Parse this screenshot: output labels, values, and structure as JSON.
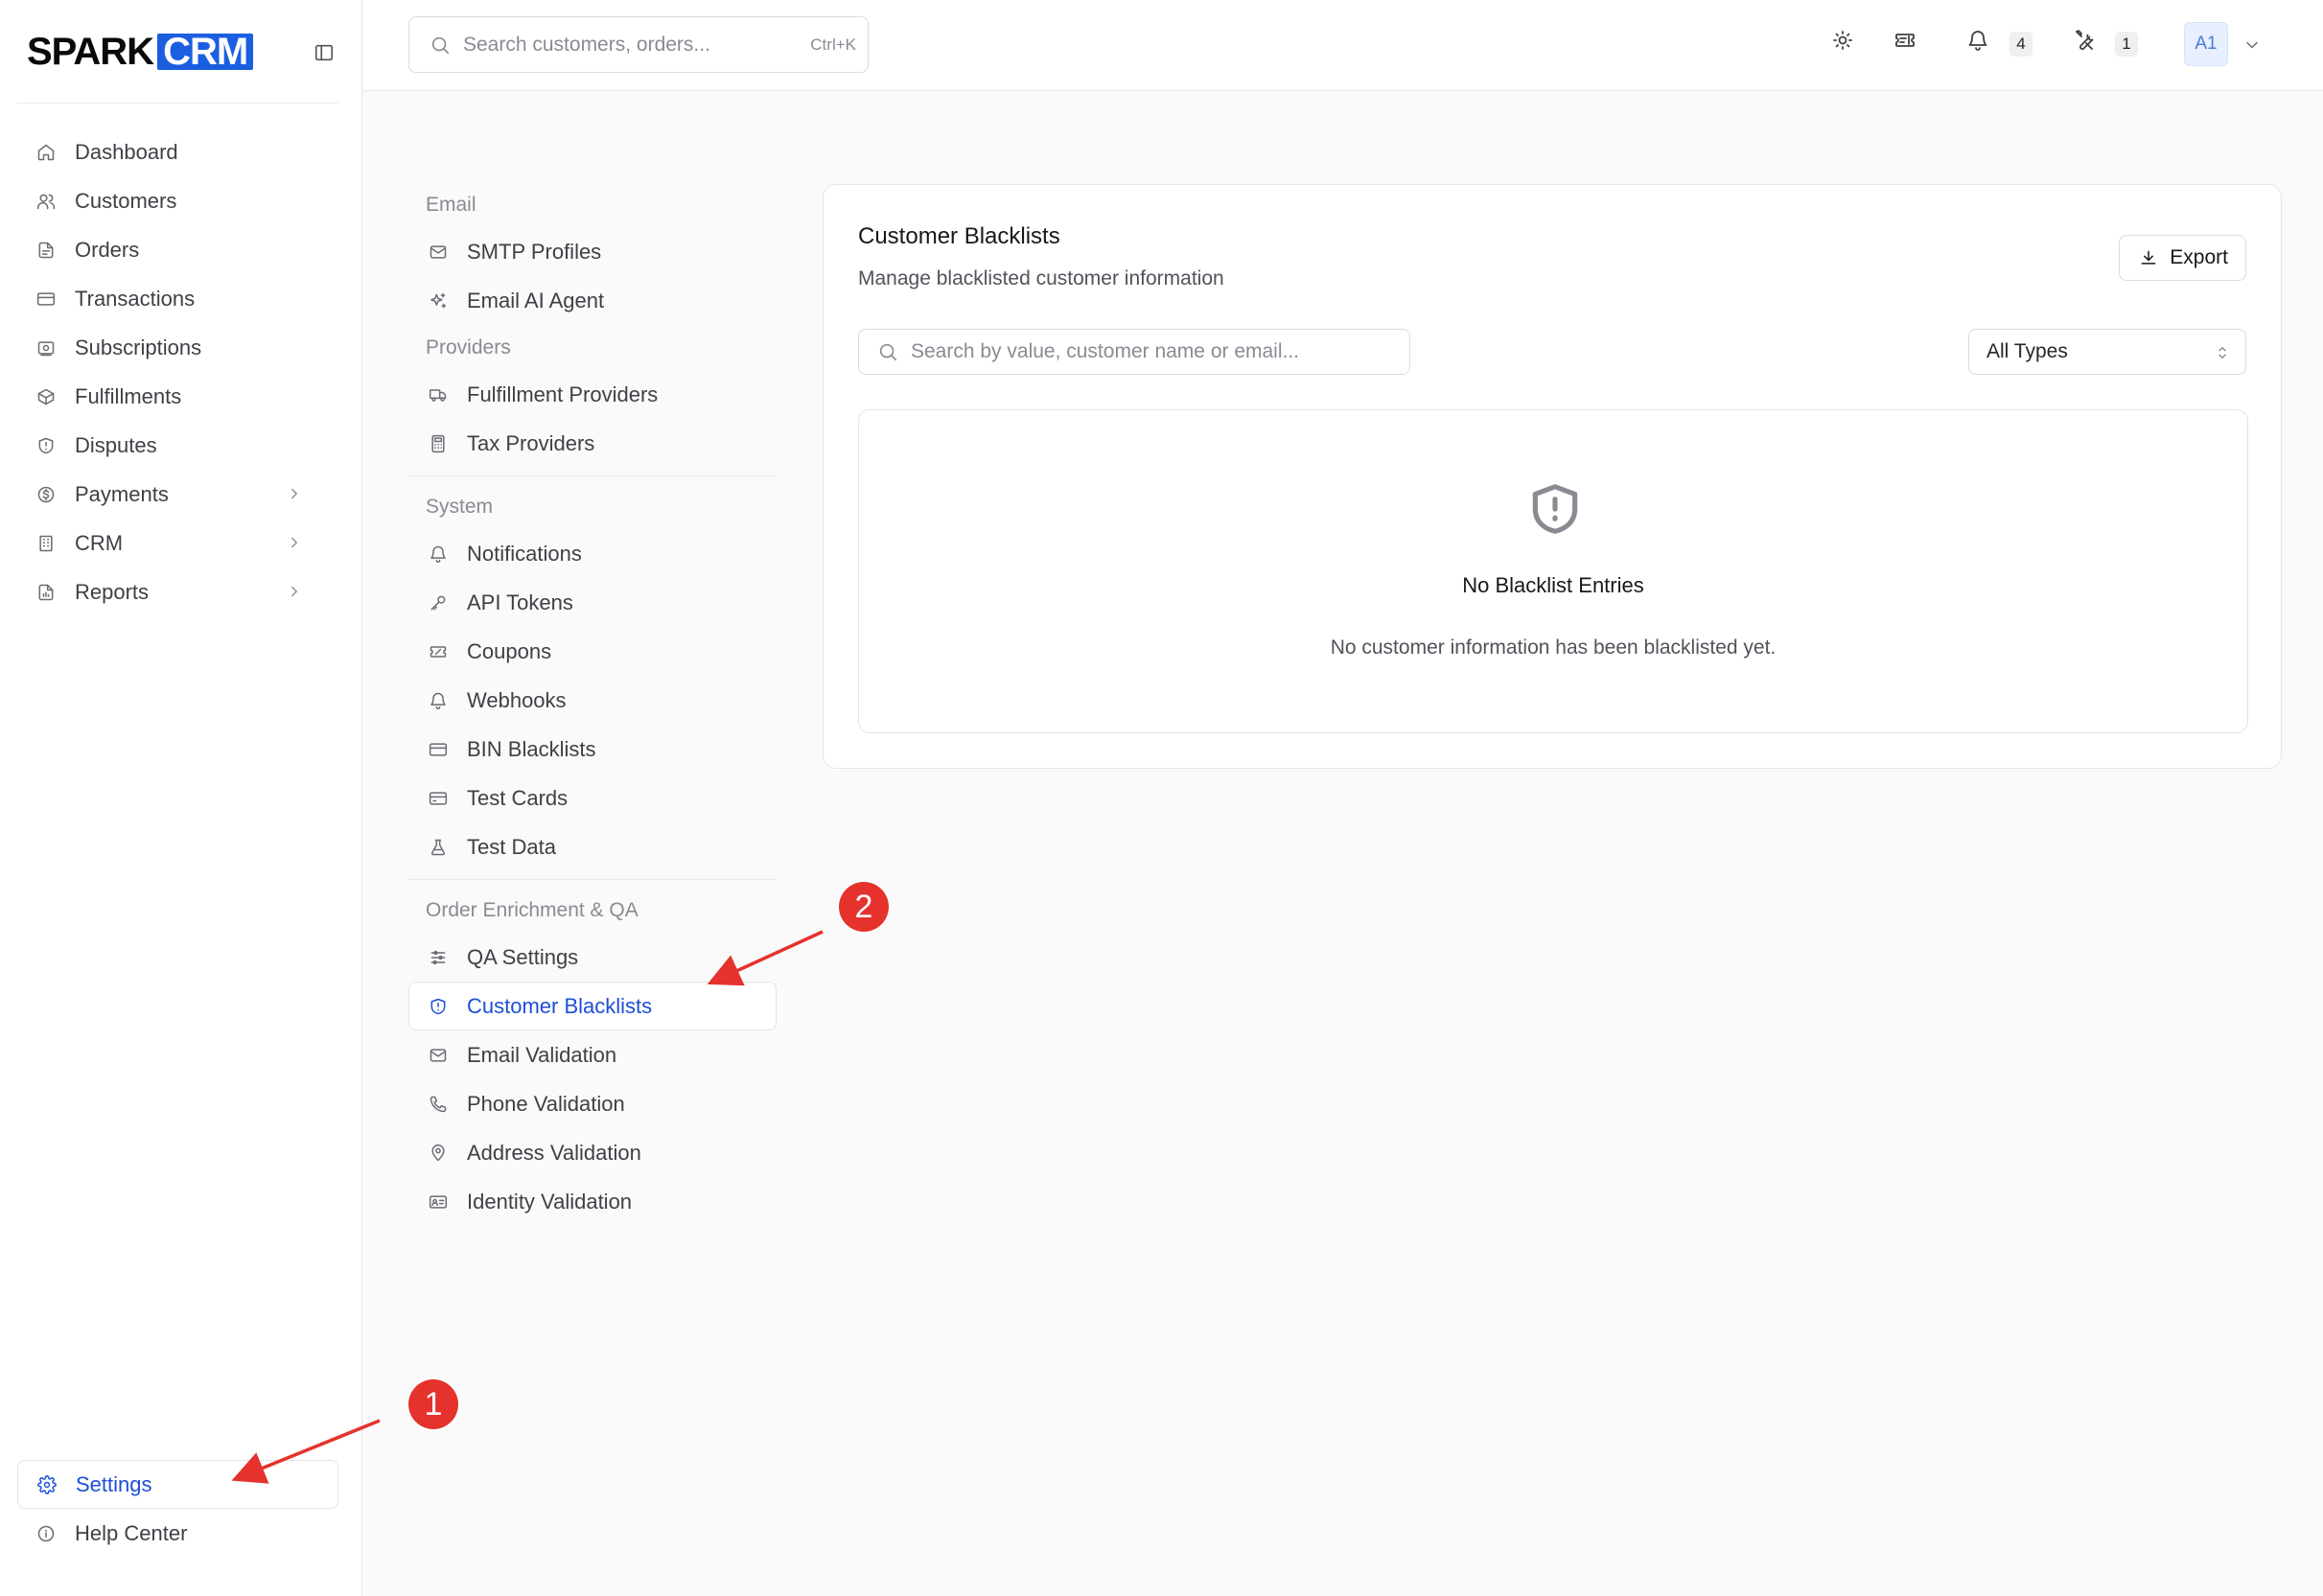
{
  "brand": {
    "name_part1": "SPARK",
    "name_part2": "CRM",
    "accent": "#1b5fe0"
  },
  "sidebar": {
    "items": [
      {
        "label": "Dashboard",
        "icon": "home-icon"
      },
      {
        "label": "Customers",
        "icon": "users-icon"
      },
      {
        "label": "Orders",
        "icon": "file-icon"
      },
      {
        "label": "Transactions",
        "icon": "credit-card-icon"
      },
      {
        "label": "Subscriptions",
        "icon": "receipt-icon"
      },
      {
        "label": "Fulfillments",
        "icon": "package-icon"
      },
      {
        "label": "Disputes",
        "icon": "shield-alert-icon"
      },
      {
        "label": "Payments",
        "icon": "dollar-icon",
        "expandable": true
      },
      {
        "label": "CRM",
        "icon": "building-icon",
        "expandable": true
      },
      {
        "label": "Reports",
        "icon": "report-icon",
        "expandable": true
      }
    ],
    "bottom": [
      {
        "label": "Settings",
        "icon": "gear-icon",
        "active": true
      },
      {
        "label": "Help Center",
        "icon": "info-icon"
      }
    ]
  },
  "topbar": {
    "search_placeholder": "Search customers, orders...",
    "search_shortcut": "Ctrl+K",
    "notifications_count": "4",
    "tools_count": "1",
    "avatar_initials": "A1"
  },
  "settings_nav": {
    "sections": [
      {
        "heading": "Email",
        "items": [
          "SMTP Profiles",
          "Email AI Agent"
        ]
      },
      {
        "heading": "Providers",
        "items": [
          "Fulfillment Providers",
          "Tax Providers"
        ]
      },
      {
        "heading": "System",
        "items": [
          "Notifications",
          "API Tokens",
          "Coupons",
          "Webhooks",
          "BIN Blacklists",
          "Test Cards",
          "Test Data"
        ]
      },
      {
        "heading": "Order Enrichment & QA",
        "items": [
          "QA Settings",
          "Customer Blacklists",
          "Email Validation",
          "Phone Validation",
          "Address Validation",
          "Identity Validation"
        ]
      }
    ],
    "active_item": "Customer Blacklists"
  },
  "main": {
    "title": "Customer Blacklists",
    "subtitle": "Manage blacklisted customer information",
    "export_label": "Export",
    "search_placeholder": "Search by value, customer name or email...",
    "type_filter_value": "All Types",
    "empty_title": "No Blacklist Entries",
    "empty_description": "No customer information has been blacklisted yet."
  },
  "annotations": {
    "marker_1": "1",
    "marker_2": "2",
    "color": "#e5322d"
  }
}
